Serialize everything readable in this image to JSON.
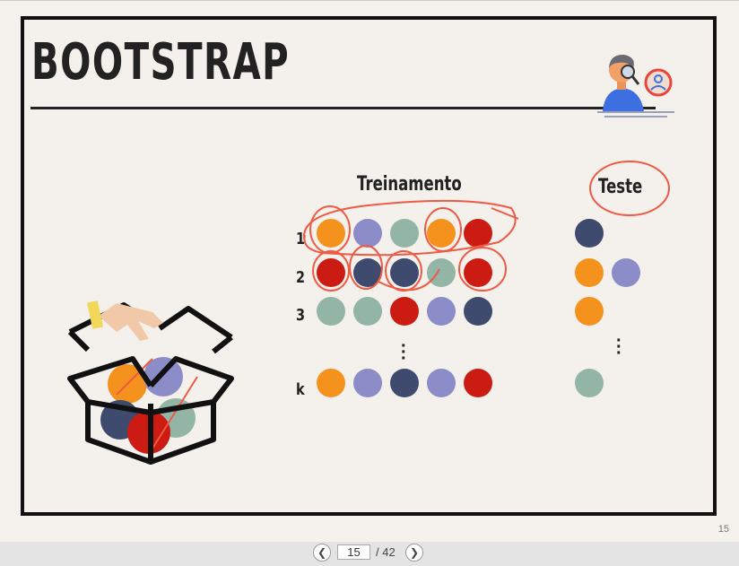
{
  "slide": {
    "title": "BOOTSTRAP",
    "treino_header": "Treinamento",
    "teste_header": "Teste",
    "rows": [
      {
        "label": "1",
        "train": [
          "orange",
          "lavender",
          "sage",
          "orange",
          "red"
        ],
        "test": [
          "navy"
        ]
      },
      {
        "label": "2",
        "train": [
          "red",
          "navy",
          "navy",
          "sage",
          "red"
        ],
        "test": [
          "orange",
          "lavender"
        ]
      },
      {
        "label": "3",
        "train": [
          "sage",
          "sage",
          "red",
          "lavender",
          "navy"
        ],
        "test": [
          "orange"
        ]
      },
      {
        "label": "k",
        "train": [
          "orange",
          "lavender",
          "navy",
          "lavender",
          "red"
        ],
        "test": [
          "sage"
        ]
      }
    ],
    "colors": {
      "orange": "#f5921e",
      "lavender": "#8c8cc8",
      "sage": "#93b5a5",
      "red": "#cc1b12",
      "navy": "#3e4a6e",
      "annotation": "#ee5a44"
    },
    "corner_page_number": "15"
  },
  "viewer": {
    "current_page": "15",
    "page_separator": "/ 42",
    "prev_icon": "chevron-left-icon",
    "next_icon": "chevron-right-icon"
  }
}
